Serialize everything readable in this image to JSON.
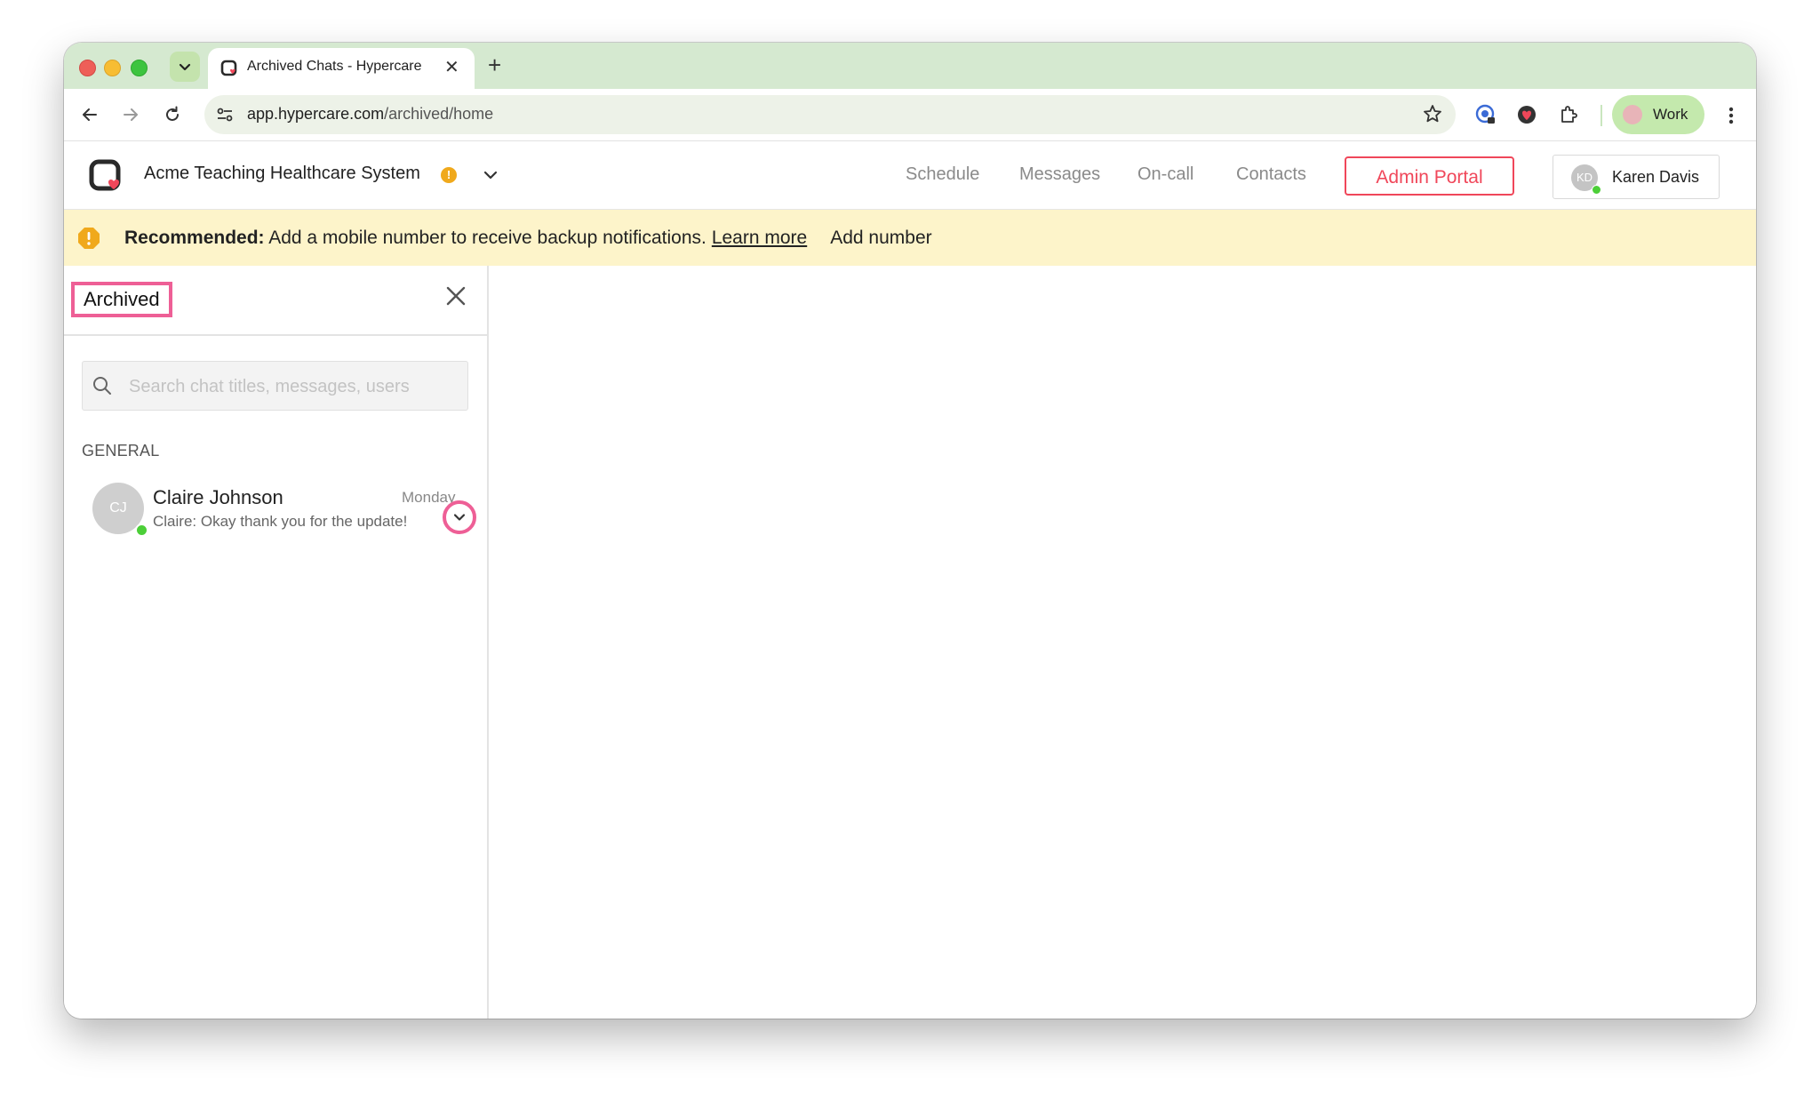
{
  "browser": {
    "tab": {
      "title": "Archived Chats - Hypercare",
      "close": "✕"
    },
    "new_tab": "+",
    "url_host": "app.hypercare.com",
    "url_path": "/archived/home",
    "profile_label": "Work"
  },
  "app": {
    "org_name": "Acme Teaching Healthcare System",
    "org_warning": "!",
    "nav": [
      "Schedule",
      "Messages",
      "On-call",
      "Contacts"
    ],
    "admin_portal": "Admin Portal",
    "user": {
      "initials": "KD",
      "name": "Karen Davis"
    }
  },
  "banner": {
    "icon_text": "!",
    "bold": "Recommended:",
    "message": "Add a mobile number to receive backup notifications.",
    "link": "Learn more",
    "action": "Add number"
  },
  "sidebar": {
    "title": "Archived",
    "search_placeholder": "Search chat titles, messages, users",
    "section": "GENERAL",
    "chats": [
      {
        "initials": "CJ",
        "name": "Claire Johnson",
        "time": "Monday",
        "preview": "Claire: Okay thank you for the update!"
      }
    ]
  },
  "colors": {
    "accent": "#f0475a",
    "highlight": "#ee5f96",
    "banner_bg": "#fdf4ca",
    "online": "#4ccf38",
    "tab_strip": "#d5e9d0"
  }
}
